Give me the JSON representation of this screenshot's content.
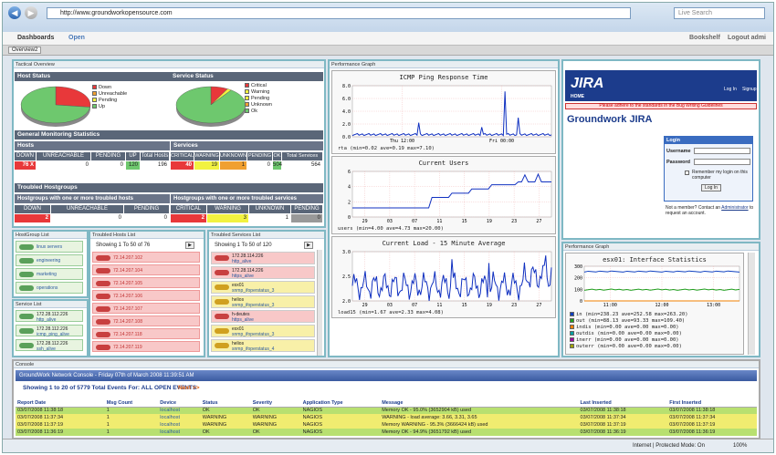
{
  "browser": {
    "url": "http://www.groundworkopensource.com",
    "search_placeholder": "Live Search",
    "status_left": "Internet | Protected Mode: On",
    "zoom": "100%"
  },
  "app": {
    "dashboards": "Dashboards",
    "open": "Open",
    "bookshelf": "Bookshelf",
    "logout": "Logout admi",
    "tab": "Overview2"
  },
  "tactical": {
    "title": "Tactical Overview",
    "host_status": "Host Status",
    "service_status": "Service Status",
    "host_legend": [
      "Down",
      "Unreachable",
      "Pending",
      "Up"
    ],
    "service_legend": [
      "Critical",
      "Warning",
      "Pending",
      "Unknown",
      "Ok"
    ],
    "host_pie": [
      {
        "label": "Down",
        "value": 27,
        "color": "#e8383a"
      },
      {
        "label": "Up",
        "value": 73,
        "color": "#6ec86e"
      }
    ],
    "service_pie": [
      {
        "label": "Critical",
        "value": 8,
        "color": "#e8383a"
      },
      {
        "label": "Warning",
        "value": 2,
        "color": "#f2f240"
      },
      {
        "label": "Ok",
        "value": 90,
        "color": "#6ec86e"
      }
    ],
    "gms": "General Monitoring Statistics",
    "hosts": "Hosts",
    "services": "Services",
    "host_cols": [
      "DOWN",
      "UNREACHABLE",
      "PENDING",
      "UP",
      "Total Hosts"
    ],
    "host_vals": [
      "76 X",
      "0",
      "0",
      "120",
      "196"
    ],
    "svc_cols": [
      "CRITICAL",
      "WARNING",
      "UNKNOWN",
      "PENDING",
      "OK",
      "Total Services"
    ],
    "svc_vals": [
      "40",
      "19",
      "1",
      "0",
      "504",
      "564"
    ],
    "troubled": "Troubled Hostgroups",
    "tg_left": "Hostgroups with one or more troubled hosts",
    "tg_right": "Hostgroups with one or more troubled services",
    "tg_left_cols": [
      "DOWN",
      "UNREACHABLE",
      "PENDING"
    ],
    "tg_left_vals": [
      "2",
      "0",
      "0"
    ],
    "tg_right_cols": [
      "CRITICAL",
      "WARNING",
      "UNKNOWN",
      "PENDING"
    ],
    "tg_right_vals": [
      "2",
      "3",
      "1",
      "0"
    ]
  },
  "hostgroups": {
    "title": "HostGroup List",
    "items": [
      "linux servers",
      "engineering",
      "marketing",
      "operations"
    ]
  },
  "services": {
    "title": "Service List",
    "items": [
      [
        "172.28.112.226",
        "http_alive"
      ],
      [
        "172.28.112.226",
        "icmp_ping_alive"
      ],
      [
        "172.28.112.226",
        "ssh_alive"
      ]
    ]
  },
  "troubled_hosts": {
    "title": "Troubled Hosts List",
    "showing": "Showing 1 To 50 of 76",
    "items": [
      "72.14.207.102",
      "72.14.207.104",
      "72.14.207.105",
      "72.14.207.106",
      "72.14.207.107",
      "72.14.207.108",
      "72.14.207.118",
      "72.14.207.119"
    ]
  },
  "troubled_services": {
    "title": "Troubled Services List",
    "showing": "Showing 1 To 50 of 120",
    "items": [
      [
        "172.28.114.226",
        "http_alive",
        "red"
      ],
      [
        "172.28.114.226",
        "https_alive",
        "red"
      ],
      [
        "esx01",
        "snmp_ifoperstatus_3",
        "yellow"
      ],
      [
        "helios",
        "snmp_ifoperstatus_3",
        "yellow"
      ],
      [
        "h-deutes",
        "https_alive",
        "red"
      ],
      [
        "esx01",
        "snmp_ifoperstatus_3",
        "yellow"
      ],
      [
        "helios",
        "snmp_ifoperstatus_4",
        "yellow"
      ]
    ]
  },
  "perf": {
    "title": "Performance Graph",
    "g1": {
      "title": "ICMP Ping Response Time",
      "yt": [
        "8.0",
        "6.0",
        "4.0",
        "2.0",
        "0.0"
      ],
      "xt": [
        "Thu 12:00",
        "Fri 00:00"
      ],
      "legend": "rta   (min=0.02  ave=0.19  max=7.10)"
    },
    "g2": {
      "title": "Current Users",
      "yt": [
        "6",
        "4",
        "2",
        "0"
      ],
      "xt": [
        "29",
        "03",
        "07",
        "11",
        "15",
        "19",
        "23",
        "27"
      ],
      "legend": "users  (min=4.00  ave=4.73  max=20.00)"
    },
    "g3": {
      "title": "Current Load - 15 Minute Average",
      "yt": [
        "3.0",
        "2.5",
        "2.0"
      ],
      "xt": [
        "29",
        "03",
        "07",
        "11",
        "15",
        "19",
        "23",
        "27"
      ],
      "legend": "load15  (min=1.67  ave=2.33  max=4.08)"
    }
  },
  "jira": {
    "logo": "JIRA",
    "home": "HOME",
    "login_link": "Log In",
    "signup": "Signup",
    "notice": "Please adhere to the standards in the Bug Writing Guidelines",
    "heading": "Groundwork JIRA",
    "login_title": "Login",
    "username": "Username",
    "password": "Password",
    "remember": "Remember my login on this computer",
    "login_btn": "Log In",
    "not_member": "Not a member? Contact an",
    "admin": "Administrator",
    "request": " to request an account."
  },
  "iface": {
    "title": "Performance Graph",
    "gtitle": "esx01: Interface Statistics",
    "yt": [
      "300",
      "200",
      "100",
      "0"
    ],
    "xt": [
      "11:00",
      "12:00",
      "13:00"
    ],
    "legend": [
      [
        "in",
        "(min=238.23",
        "ave=252.58",
        "max=263.20)",
        "#1040c0"
      ],
      [
        "out",
        "(min=88.13",
        "ave=93.33",
        "max=109.40)",
        "#20a020"
      ],
      [
        "indis",
        "(min=0.00",
        "ave=0.00",
        "max=0.00)",
        "#f08000"
      ],
      [
        "outdis",
        "(min=0.00",
        "ave=0.00",
        "max=0.00)",
        "#00a0a0"
      ],
      [
        "inerr",
        "(min=0.00",
        "ave=0.00",
        "max=0.00)",
        "#a000a0"
      ],
      [
        "outerr",
        "(min=0.00",
        "ave=0.00",
        "max=0.00)",
        "#a0a000"
      ]
    ]
  },
  "console": {
    "title": "Console",
    "banner": "GroundWork Network Console - Friday 07th of March 2008 11:39:51 AM",
    "showing": "Showing 1 to 20 of 5779 Total Events For: ALL OPEN EVENTS",
    "next": "Next >>",
    "cols": [
      "Report Date",
      "Msg Count",
      "Device",
      "Status",
      "Severity",
      "Application Type",
      "Message",
      "Last Inserted",
      "First Inserted"
    ],
    "rows": [
      [
        "03/07/2008 11:38:18",
        "1",
        "localhost",
        "OK",
        "OK",
        "NAGIOS",
        "Memory OK - 95.0% (3652904 kB) used",
        "03/07/2008 11:38:18",
        "03/07/2008 11:38:18",
        "g"
      ],
      [
        "03/07/2008 11:37:34",
        "1",
        "localhost",
        "WARNING",
        "WARNING",
        "NAGIOS",
        "WARNING - load average: 3.66, 3.31, 3.65",
        "03/07/2008 11:37:34",
        "03/07/2008 11:37:34",
        "y"
      ],
      [
        "03/07/2008 11:37:19",
        "1",
        "localhost",
        "WARNING",
        "WARNING",
        "NAGIOS",
        "Memory WARNING - 95.3% (3666424 kB) used",
        "03/07/2008 11:37:19",
        "03/07/2008 11:37:19",
        "y"
      ],
      [
        "03/07/2008 11:36:19",
        "1",
        "localhost",
        "OK",
        "OK",
        "NAGIOS",
        "Memory OK - 94.9% (3651792 kB) used",
        "03/07/2008 11:36:19",
        "03/07/2008 11:36:19",
        "g"
      ]
    ]
  }
}
